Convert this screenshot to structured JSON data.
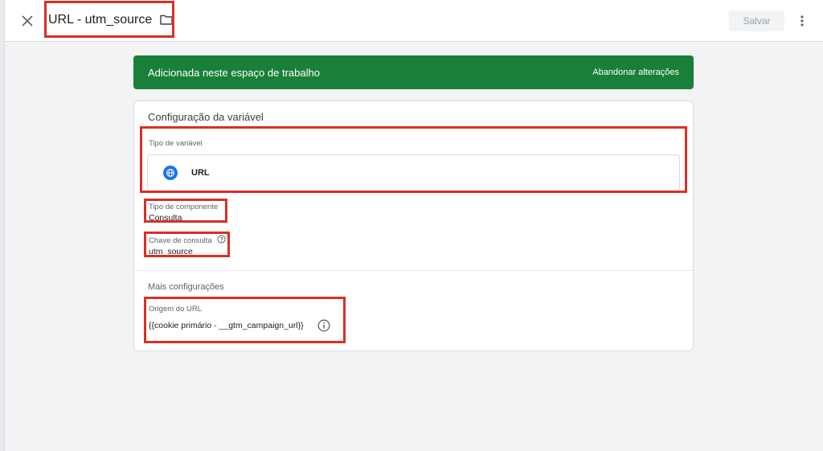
{
  "header": {
    "title": "URL - utm_source",
    "save_label": "Salvar"
  },
  "banner": {
    "text": "Adicionada neste espaço de trabalho",
    "action": "Abandonar alterações",
    "color": "#188038"
  },
  "config": {
    "title": "Configuração da variável",
    "variable_type": {
      "label": "Tipo de variável",
      "value": "URL",
      "icon": "globe-icon"
    },
    "component_type": {
      "label": "Tipo de componente",
      "value": "Consulta"
    },
    "query_key": {
      "label": "Chave de consulta",
      "value": "utm_source",
      "icon": "help-circle-icon"
    }
  },
  "more_settings": {
    "title": "Mais configurações",
    "url_source": {
      "label": "Origem do URL",
      "value": "{{cookie primário - __gtm_campaign_url}}",
      "icon": "info-icon"
    }
  },
  "colors": {
    "highlight": "#d93025",
    "accent": "#1a73e8"
  }
}
